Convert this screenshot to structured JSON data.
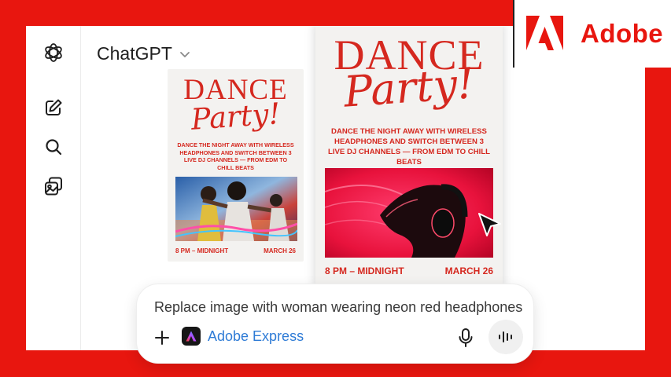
{
  "app": {
    "title": "ChatGPT"
  },
  "sidebar": {
    "items": [
      {
        "icon": "openai-logo-icon"
      },
      {
        "icon": "new-chat-icon"
      },
      {
        "icon": "search-icon"
      },
      {
        "icon": "images-icon"
      }
    ]
  },
  "posters": [
    {
      "title_line1": "DANCE",
      "title_line2": "Party!",
      "description": "DANCE THE NIGHT AWAY WITH WIRELESS HEADPHONES AND SWITCH BETWEEN 3 LIVE DJ CHANNELS — FROM EDM TO CHILL BEATS",
      "time": "8 PM – MIDNIGHT",
      "date": "MARCH 26"
    },
    {
      "title_line1": "DANCE",
      "title_line2": "Party!",
      "description": "DANCE THE NIGHT AWAY WITH WIRELESS HEADPHONES AND SWITCH BETWEEN 3 LIVE DJ CHANNELS — FROM EDM TO CHILL BEATS",
      "time": "8 PM – MIDNIGHT",
      "date": "MARCH 26"
    }
  ],
  "composer": {
    "prompt": "Replace image with woman wearing neon red headphones",
    "tool_label": "Adobe Express"
  },
  "brand": {
    "name": "Adobe",
    "color": "#e8160f"
  }
}
